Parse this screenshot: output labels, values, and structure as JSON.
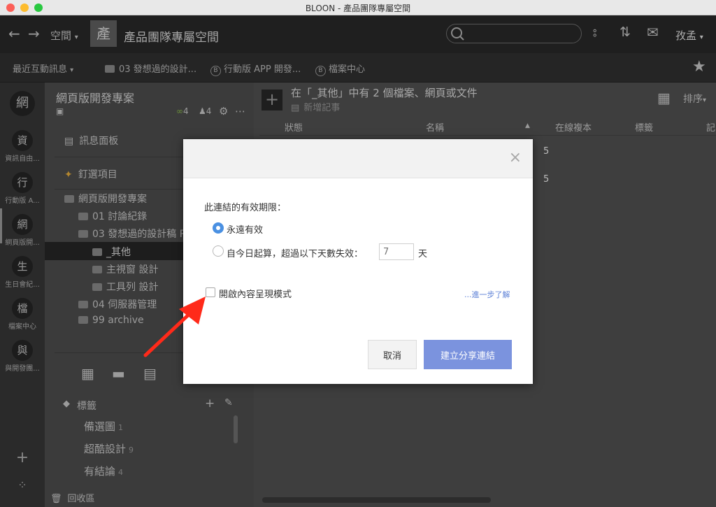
{
  "window": {
    "title": "BLOON - 產品團隊專屬空間"
  },
  "topnav": {
    "space_menu": "空間",
    "space_badge": "產",
    "space_name": "產品團隊專屬空間",
    "user": "孜孟"
  },
  "subnav": {
    "recent": "最近互動訊息",
    "crumb1": "03 發想過的設計...",
    "crumb2_badge": "B",
    "crumb2": "行動版 APP 開發...",
    "crumb3_badge": "B",
    "crumb3": "檔案中心"
  },
  "rail": {
    "items": [
      {
        "glyph": "網",
        "label": ""
      },
      {
        "glyph": "資",
        "label": "資訊自由..."
      },
      {
        "glyph": "行",
        "label": "行動版 A..."
      },
      {
        "glyph": "網",
        "label": "網頁版開..."
      },
      {
        "glyph": "生",
        "label": "生日會紀..."
      },
      {
        "glyph": "檔",
        "label": "檔案中心"
      },
      {
        "glyph": "與",
        "label": "與開發團..."
      }
    ]
  },
  "sidebar": {
    "title": "網頁版開發專案",
    "link_count": "4",
    "member_count": "4",
    "message_board": "訊息面板",
    "pinned": "釘選項目",
    "project_root": "網頁版開發專案",
    "tree": [
      "01 討論紀錄",
      "03 發想過的設計稿 P",
      "_其他",
      "主視窗 設計",
      "工具列 設計",
      "04 伺服器管理",
      "99 archive"
    ],
    "tags_label": "標籤",
    "tags": [
      {
        "name": "備選圖",
        "count": "1"
      },
      {
        "name": "超酷設計",
        "count": "9"
      },
      {
        "name": "有結論",
        "count": "4"
      }
    ],
    "trash": "回收區"
  },
  "main": {
    "heading": "在「_其他」中有 2 個檔案、網頁或文件",
    "new_note": "新增記事",
    "sort": "排序",
    "columns": [
      "狀態",
      "名稱",
      "在線複本",
      "標籤",
      "記"
    ],
    "row_values": [
      "5",
      "5"
    ]
  },
  "dialog": {
    "validity_label": "此連結的有效期限：",
    "option_forever": "永遠有效",
    "option_days": "自今日起算，超過以下天數失效：",
    "days_placeholder": "7",
    "days_unit": "天",
    "content_mode": "開啟內容呈現模式",
    "learn_more": "...進一步了解",
    "cancel": "取消",
    "create": "建立分享連結",
    "close_symbol": "×",
    "selected_option": "永遠有效"
  },
  "colors": {
    "accent": "#7b93de",
    "radio_selected": "#4a90e2",
    "annotation_arrow": "#ff2a1a"
  }
}
